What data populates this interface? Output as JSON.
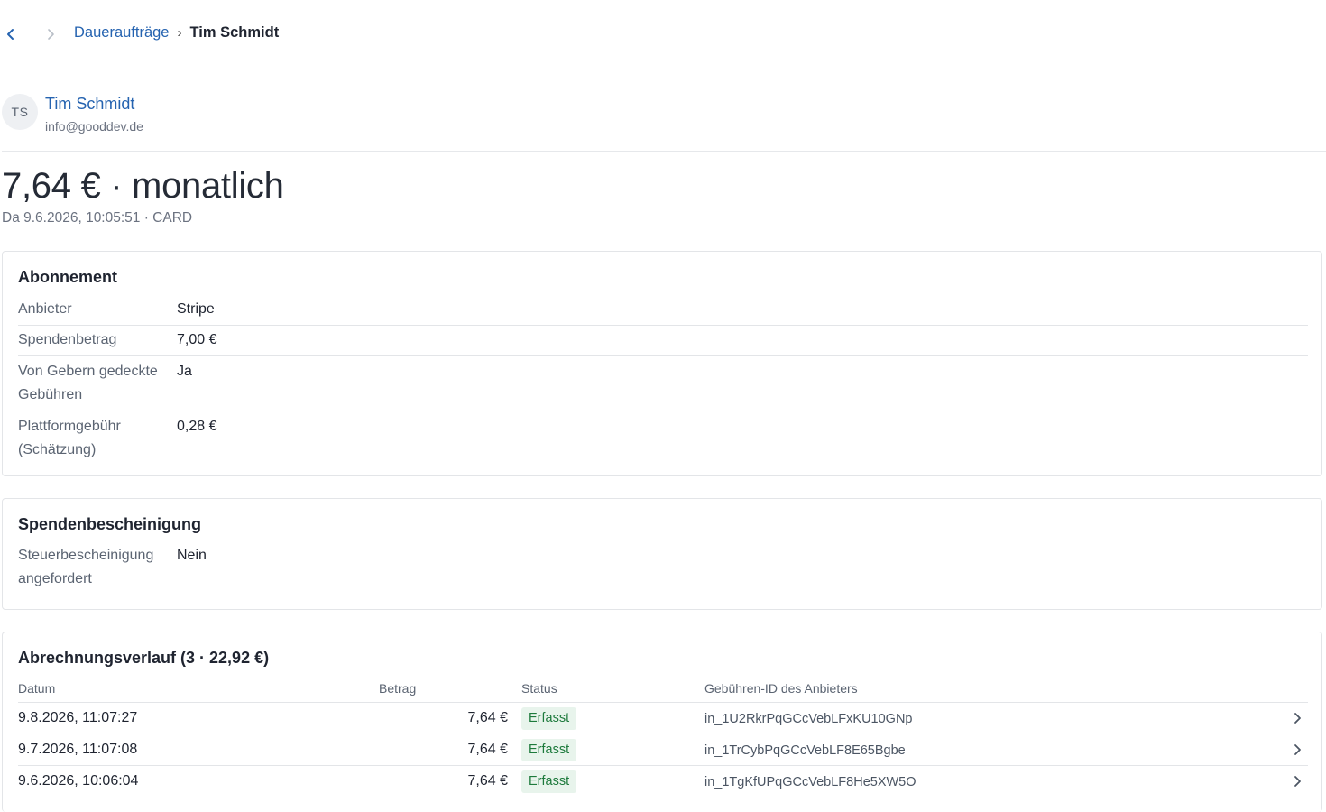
{
  "breadcrumb": {
    "parent": "Daueraufträge",
    "separator": "›",
    "current": "Tim Schmidt"
  },
  "donor": {
    "initials": "TS",
    "name": "Tim Schmidt",
    "email": "info@gooddev.de"
  },
  "summary": {
    "headline": "7,64 € · monatlich",
    "subline": "Da 9.6.2026, 10:05:51 · CARD"
  },
  "subscription": {
    "title": "Abonnement",
    "rows": [
      {
        "key": "Anbieter",
        "value": "Stripe"
      },
      {
        "key": "Spendenbetrag",
        "value": "7,00 €"
      },
      {
        "key": "Von Gebern gedeckte Gebühren",
        "value": "Ja"
      },
      {
        "key": "Plattformgebühr (Schätzung)",
        "value": "0,28 €"
      }
    ]
  },
  "receipt": {
    "title": "Spendenbescheinigung",
    "rows": [
      {
        "key": "Steuerbescheinigung angefordert",
        "value": "Nein"
      }
    ]
  },
  "billing": {
    "title": "Abrechnungsverlauf (3 · 22,92 €)",
    "columns": {
      "date": "Datum",
      "amount": "Betrag",
      "status": "Status",
      "provider_id": "Gebühren-ID des Anbieters"
    },
    "rows": [
      {
        "date": "9.8.2026, 11:07:27",
        "amount": "7,64 €",
        "status": "Erfasst",
        "provider_id": "in_1U2RkrPqGCcVebLFxKU10GNp"
      },
      {
        "date": "9.7.2026, 11:07:08",
        "amount": "7,64 €",
        "status": "Erfasst",
        "provider_id": "in_1TrCybPqGCcVebLF8E65Bgbe"
      },
      {
        "date": "9.6.2026, 10:06:04",
        "amount": "7,64 €",
        "status": "Erfasst",
        "provider_id": "in_1TgKfUPqGCcVebLF8He5XW5O"
      }
    ]
  },
  "colors": {
    "link": "#2563b0",
    "status_text": "#1d7a3c",
    "status_bg": "#e8f4ec",
    "border": "#e3e5e8"
  },
  "icons": {
    "back": "chevron-left-icon",
    "forward": "chevron-right-icon",
    "row_open": "chevron-right-icon"
  }
}
